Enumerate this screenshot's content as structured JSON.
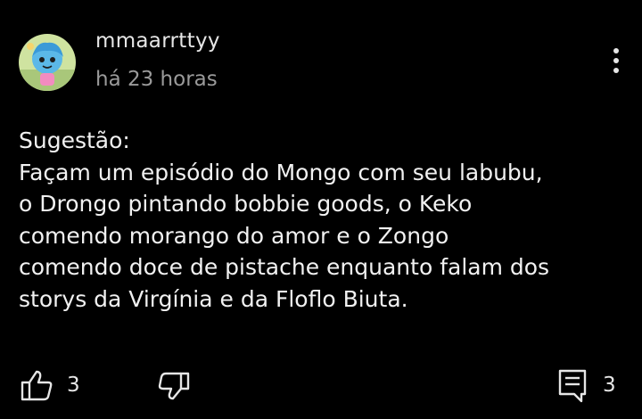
{
  "comment": {
    "author": "mmaarrttyy",
    "timestamp": "há 23 horas",
    "text_lines": [
      "Sugestão:",
      "Façam um episódio do Mongo com seu labubu,",
      "o Drongo pintando bobbie goods, o Keko",
      "comendo morango do amor e o Zongo",
      "comendo doce de pistache enquanto falam dos",
      "storys da Virgínia e da Floflo Biuta."
    ],
    "likes": "3",
    "replies": "3"
  },
  "icons": {
    "avatar": "avatar-image",
    "more": "more-vertical-icon",
    "like": "thumbs-up-icon",
    "dislike": "thumbs-down-icon",
    "reply": "comment-icon"
  },
  "colors": {
    "background": "#000000",
    "text": "#f1f1f1",
    "secondary_text": "#9a9a9a"
  }
}
